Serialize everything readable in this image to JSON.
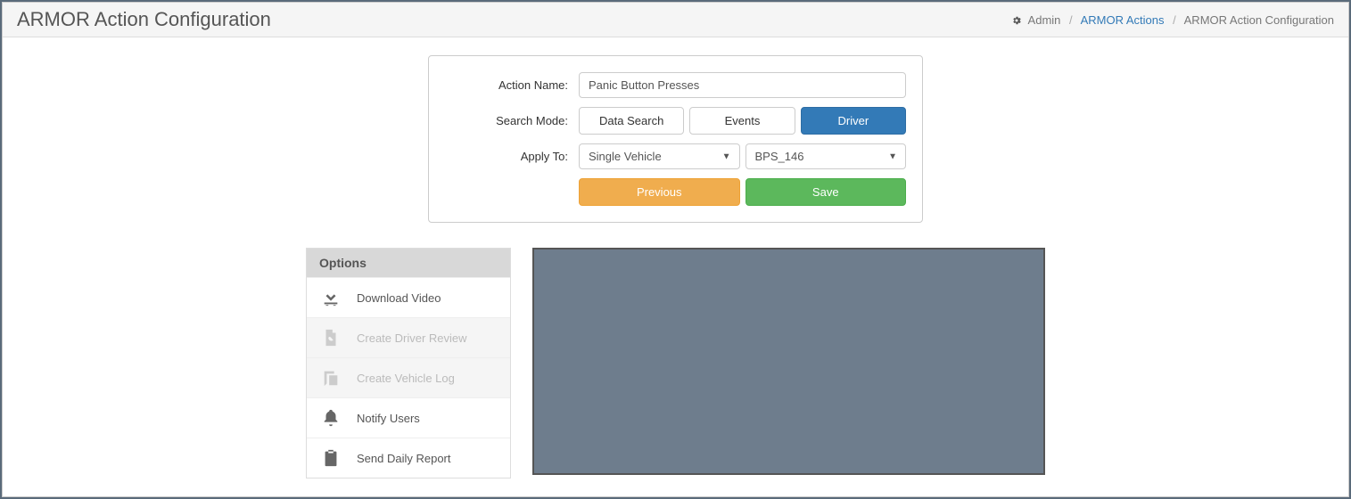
{
  "header": {
    "title": "ARMOR Action Configuration"
  },
  "breadcrumb": {
    "admin_label": "Admin",
    "actions_label": "ARMOR Actions",
    "current_label": "ARMOR Action Configuration"
  },
  "form": {
    "action_name_label": "Action Name:",
    "action_name_value": "Panic Button Presses",
    "search_mode_label": "Search Mode:",
    "search_modes": {
      "data_search": "Data Search",
      "events": "Events",
      "driver": "Driver"
    },
    "search_mode_selected": "driver",
    "apply_to_label": "Apply To:",
    "apply_to_value": "Single Vehicle",
    "vehicle_value": "BPS_146",
    "previous_label": "Previous",
    "save_label": "Save"
  },
  "options": {
    "header": "Options",
    "items": [
      {
        "label": "Download Video",
        "enabled": true,
        "icon": "download"
      },
      {
        "label": "Create Driver Review",
        "enabled": false,
        "icon": "pdf"
      },
      {
        "label": "Create Vehicle Log",
        "enabled": false,
        "icon": "log"
      },
      {
        "label": "Notify Users",
        "enabled": true,
        "icon": "bell"
      },
      {
        "label": "Send Daily Report",
        "enabled": true,
        "icon": "clipboard"
      }
    ]
  }
}
